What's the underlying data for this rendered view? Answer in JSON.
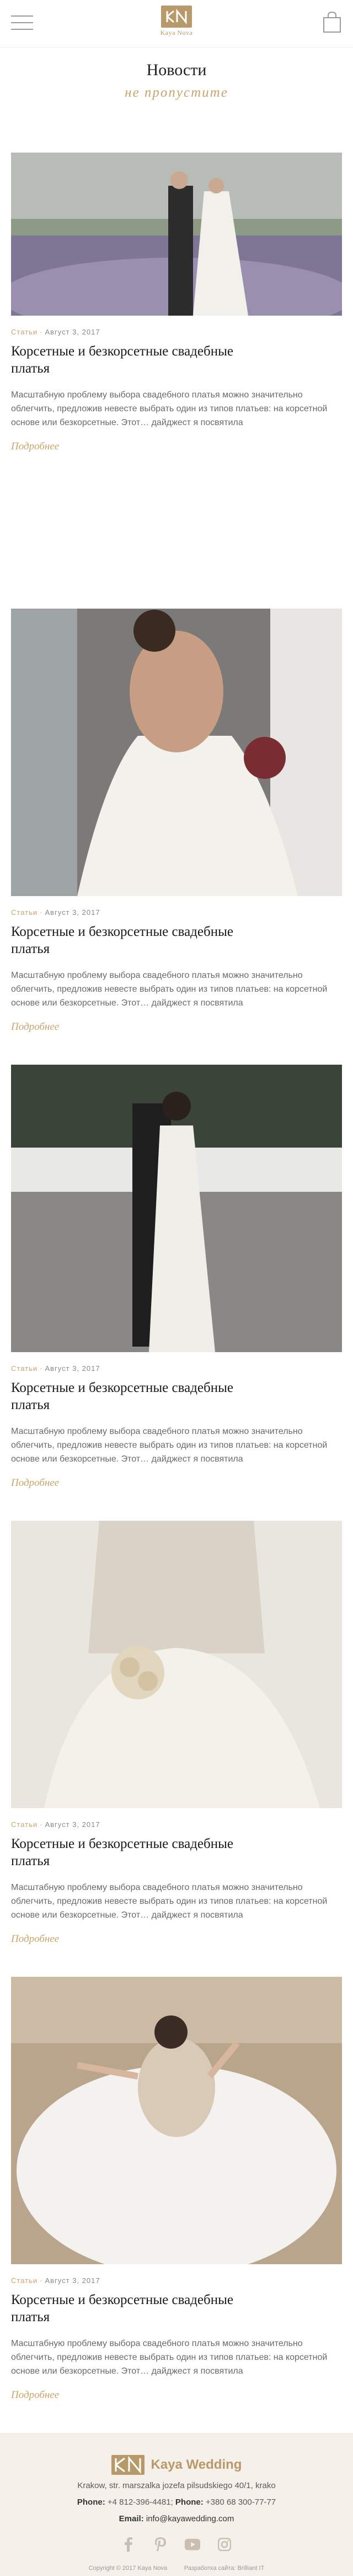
{
  "header": {
    "logo_text": "Kaya Nova",
    "menu_icon": "hamburger-icon",
    "cart_icon": "shopping-bag-icon"
  },
  "page": {
    "title": "Новости",
    "subtitle": "не пропустите"
  },
  "articles": [
    {
      "category": "Статьи",
      "date": "Август 3, 2017",
      "title": "Корсетные и безкорсетные свадебные платья",
      "excerpt": "Масштабную проблему выбора свадебного платья можно значительно облегчить, предложив невесте выбрать один из типов платьев: на корсетной основе или безкорсетные. Этот… дайджест я посвятила",
      "more": "Подробнее"
    },
    {
      "category": "Статьи",
      "date": "Август 3, 2017",
      "title": "Корсетные и безкорсетные свадебные платья",
      "excerpt": "Масштабную проблему выбора свадебного платья можно значительно облегчить, предложив невесте выбрать один из типов платьев: на корсетной основе или безкорсетные. Этот… дайджест я посвятила",
      "more": "Подробнее"
    },
    {
      "category": "Статьи",
      "date": "Август 3, 2017",
      "title": "Корсетные и безкорсетные свадебные платья",
      "excerpt": "Масштабную проблему выбора свадебного платья можно значительно облегчить, предложив невесте выбрать один из типов платьев: на корсетной основе или безкорсетные. Этот… дайджест я посвятила",
      "more": "Подробнее"
    },
    {
      "category": "Статьи",
      "date": "Август 3, 2017",
      "title": "Корсетные и безкорсетные свадебные платья",
      "excerpt": "Масштабную проблему выбора свадебного платья можно значительно облегчить, предложив невесте выбрать один из типов платьев: на корсетной основе или безкорсетные. Этот… дайджест я посвятила",
      "more": "Подробнее"
    },
    {
      "category": "Статьи",
      "date": "Август 3, 2017",
      "title": "Корсетные и безкорсетные свадебные платья",
      "excerpt": "Масштабную проблему выбора свадебного платья можно значительно облегчить, предложив невесте выбрать один из типов платьев: на корсетной основе или безкорсетные. Этот… дайджест я посвятила",
      "more": "Подробнее"
    }
  ],
  "footer": {
    "brand": "Kaya Wedding",
    "address": "Krakow, str. marszalka jozefa pilsudskiego 40/1, krako",
    "phone_label_1": "Phone:",
    "phone_1": "+4 812-396-4481;",
    "phone_label_2": "Phone:",
    "phone_2": "+380 68 300-77-77",
    "email_label": "Email:",
    "email": "info@kayawedding.com",
    "copyright": "Copyright © 2017 Kaya Nova",
    "developer": "Разработка сайта: Brilliant IT"
  },
  "colors": {
    "accent": "#c9a56a",
    "brand": "#b89a6a",
    "footer_bg": "#f5f1ea"
  }
}
